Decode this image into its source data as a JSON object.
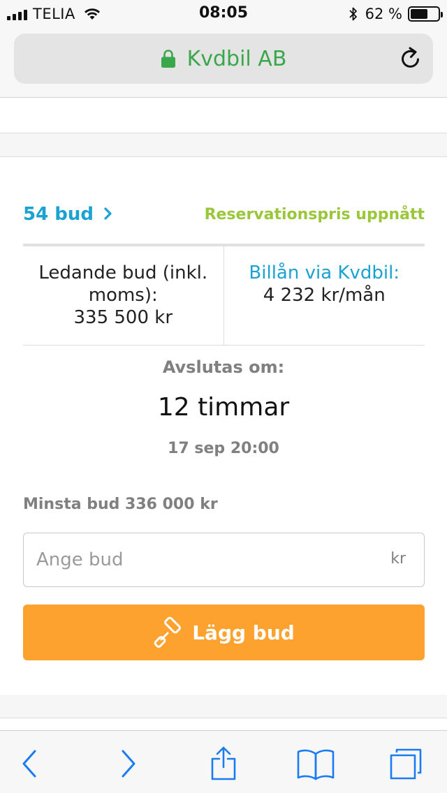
{
  "status_bar": {
    "carrier": "TELIA",
    "time": "08:05",
    "battery_percent": "62 %",
    "battery_level": 0.62
  },
  "address_bar": {
    "site_title": "Kvdbil AB"
  },
  "auction": {
    "bids_link": "54 bud",
    "reserve_status": "Reservationspris uppnått",
    "leading_bid_label": "Ledande bud (inkl. moms):",
    "leading_bid_value": "335 500 kr",
    "loan_label": "Billån via Kvdbil:",
    "loan_value": "4 232 kr/mån",
    "ends_label": "Avslutas om:",
    "ends_value": "12 timmar",
    "ends_date": "17 sep 20:00",
    "min_bid": "Minsta bud 336 000 kr"
  },
  "bid_form": {
    "input_placeholder": "Ange bud",
    "unit": "kr",
    "button_label": "Lägg bud"
  },
  "colors": {
    "accent_blue": "#1aa2d3",
    "reserve_green": "#9ac73a",
    "secure_green": "#3aa74b",
    "button_orange": "#fda12f",
    "toolbar_blue": "#1a7cf2"
  },
  "toolbar": {
    "icons": [
      "back-icon",
      "forward-icon",
      "share-icon",
      "bookmarks-icon",
      "tabs-icon"
    ]
  }
}
